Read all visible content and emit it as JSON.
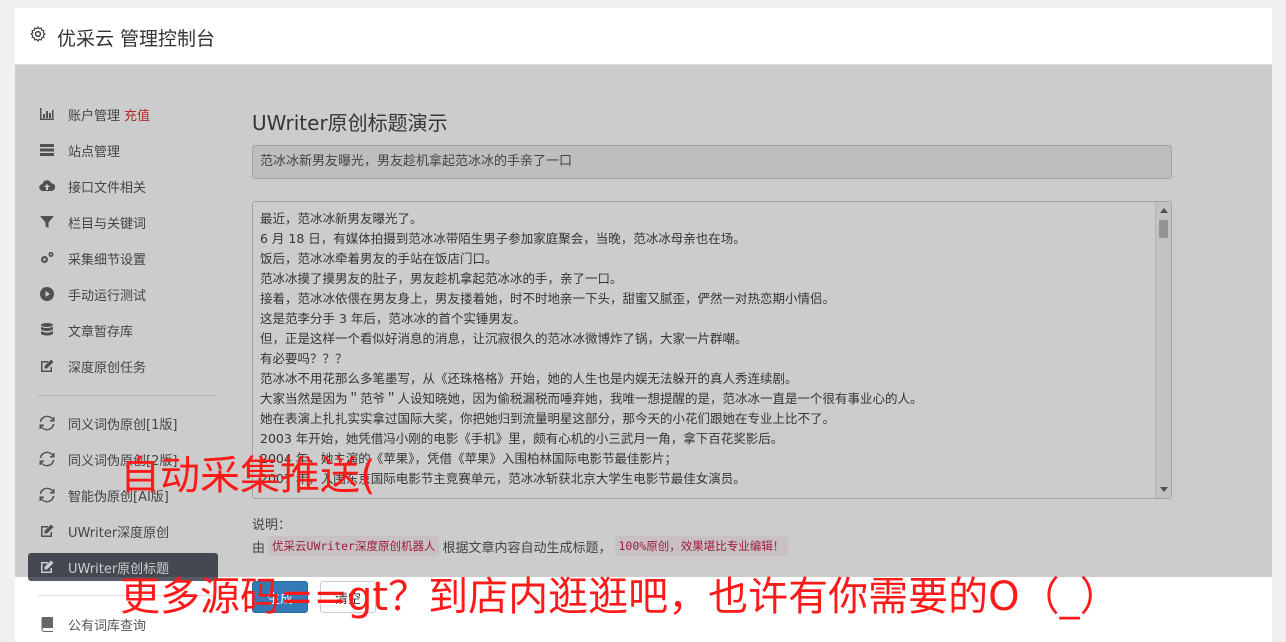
{
  "header": {
    "title": "优采云 管理控制台",
    "icon": "gear-icon"
  },
  "sidebar": {
    "items": [
      {
        "label": "账户管理",
        "accent": "充值",
        "icon": "bar-chart-icon"
      },
      {
        "label": "站点管理",
        "icon": "server-icon"
      },
      {
        "label": "接口文件相关",
        "icon": "cloud-upload-icon"
      },
      {
        "label": "栏目与关键词",
        "icon": "filter-icon"
      },
      {
        "label": "采集细节设置",
        "icon": "cogs-icon"
      },
      {
        "label": "手动运行测试",
        "icon": "play-circle-icon"
      },
      {
        "label": "文章暂存库",
        "icon": "database-icon"
      },
      {
        "label": "深度原创任务",
        "icon": "edit-icon"
      },
      {
        "label": "同义词伪原创[1版]",
        "icon": "refresh-icon"
      },
      {
        "label": "同义词伪原创[2版]",
        "icon": "refresh-icon"
      },
      {
        "label": "智能伪原创[AI版]",
        "icon": "refresh-icon"
      },
      {
        "label": "UWriter深度原创",
        "icon": "edit-icon"
      },
      {
        "label": "UWriter原创标题",
        "icon": "edit-icon",
        "active": true
      },
      {
        "label": "公有词库查询",
        "icon": "book-icon"
      }
    ]
  },
  "main": {
    "title": "UWriter原创标题演示",
    "title_value": "范冰冰新男友曝光，男友趁机拿起范冰冰的手亲了一口",
    "article_lines": [
      "最近，范冰冰新男友曝光了。",
      "6 月 18 日，有媒体拍摄到范冰冰带陌生男子参加家庭聚会，当晚，范冰冰母亲也在场。",
      "饭后，范冰冰牵着男友的手站在饭店门口。",
      "范冰冰摸了摸男友的肚子，男友趁机拿起范冰冰的手，亲了一口。",
      "接着，范冰冰依偎在男友身上，男友搂着她，时不时地亲一下头，甜蜜又腻歪，俨然一对热恋期小情侣。",
      "这是范李分手 3 年后，范冰冰的首个实锤男友。",
      "但，正是这样一个看似好消息的消息，让沉寂很久的范冰冰微博炸了锅，大家一片群嘲。",
      "有必要吗？？？",
      "范冰冰不用花那么多笔墨写，从《还珠格格》开始，她的人生也是内娱无法躲开的真人秀连续剧。",
      "大家当然是因为＂范爷＂人设知晓她，因为偷税漏税而唾弃她，我唯一想提醒的是，范冰冰一直是一个很有事业心的人。",
      "她在表演上扎扎实实拿过国际大奖，你把她归到流量明星这部分，那今天的小花们跟她在专业上比不了。",
      "2003 年开始，她凭借冯小刚的电影《手机》里，颇有心机的小三武月一角，拿下百花奖影后。",
      "2004 年，她主演的《苹果》，凭借《苹果》入围柏林国际电影节最佳影片；",
      "2007 年，入围东京国际电影节主竞赛单元，范冰冰斩获北京大学生电影节最佳女演员。"
    ],
    "note_label": "说明：",
    "note_prefix": "由",
    "note_code1": "优采云UWriter深度原创机器人",
    "note_middle": "根据文章内容自动生成标题，",
    "note_code2": "100%原创，效果堪比专业编辑！",
    "buttons": {
      "primary": "生成",
      "secondary": "清空"
    }
  },
  "watermark": {
    "line1": "自动采集推送(",
    "line2": "更多源码==gt？到店内逛逛吧，也许有你需要的O（_）"
  }
}
